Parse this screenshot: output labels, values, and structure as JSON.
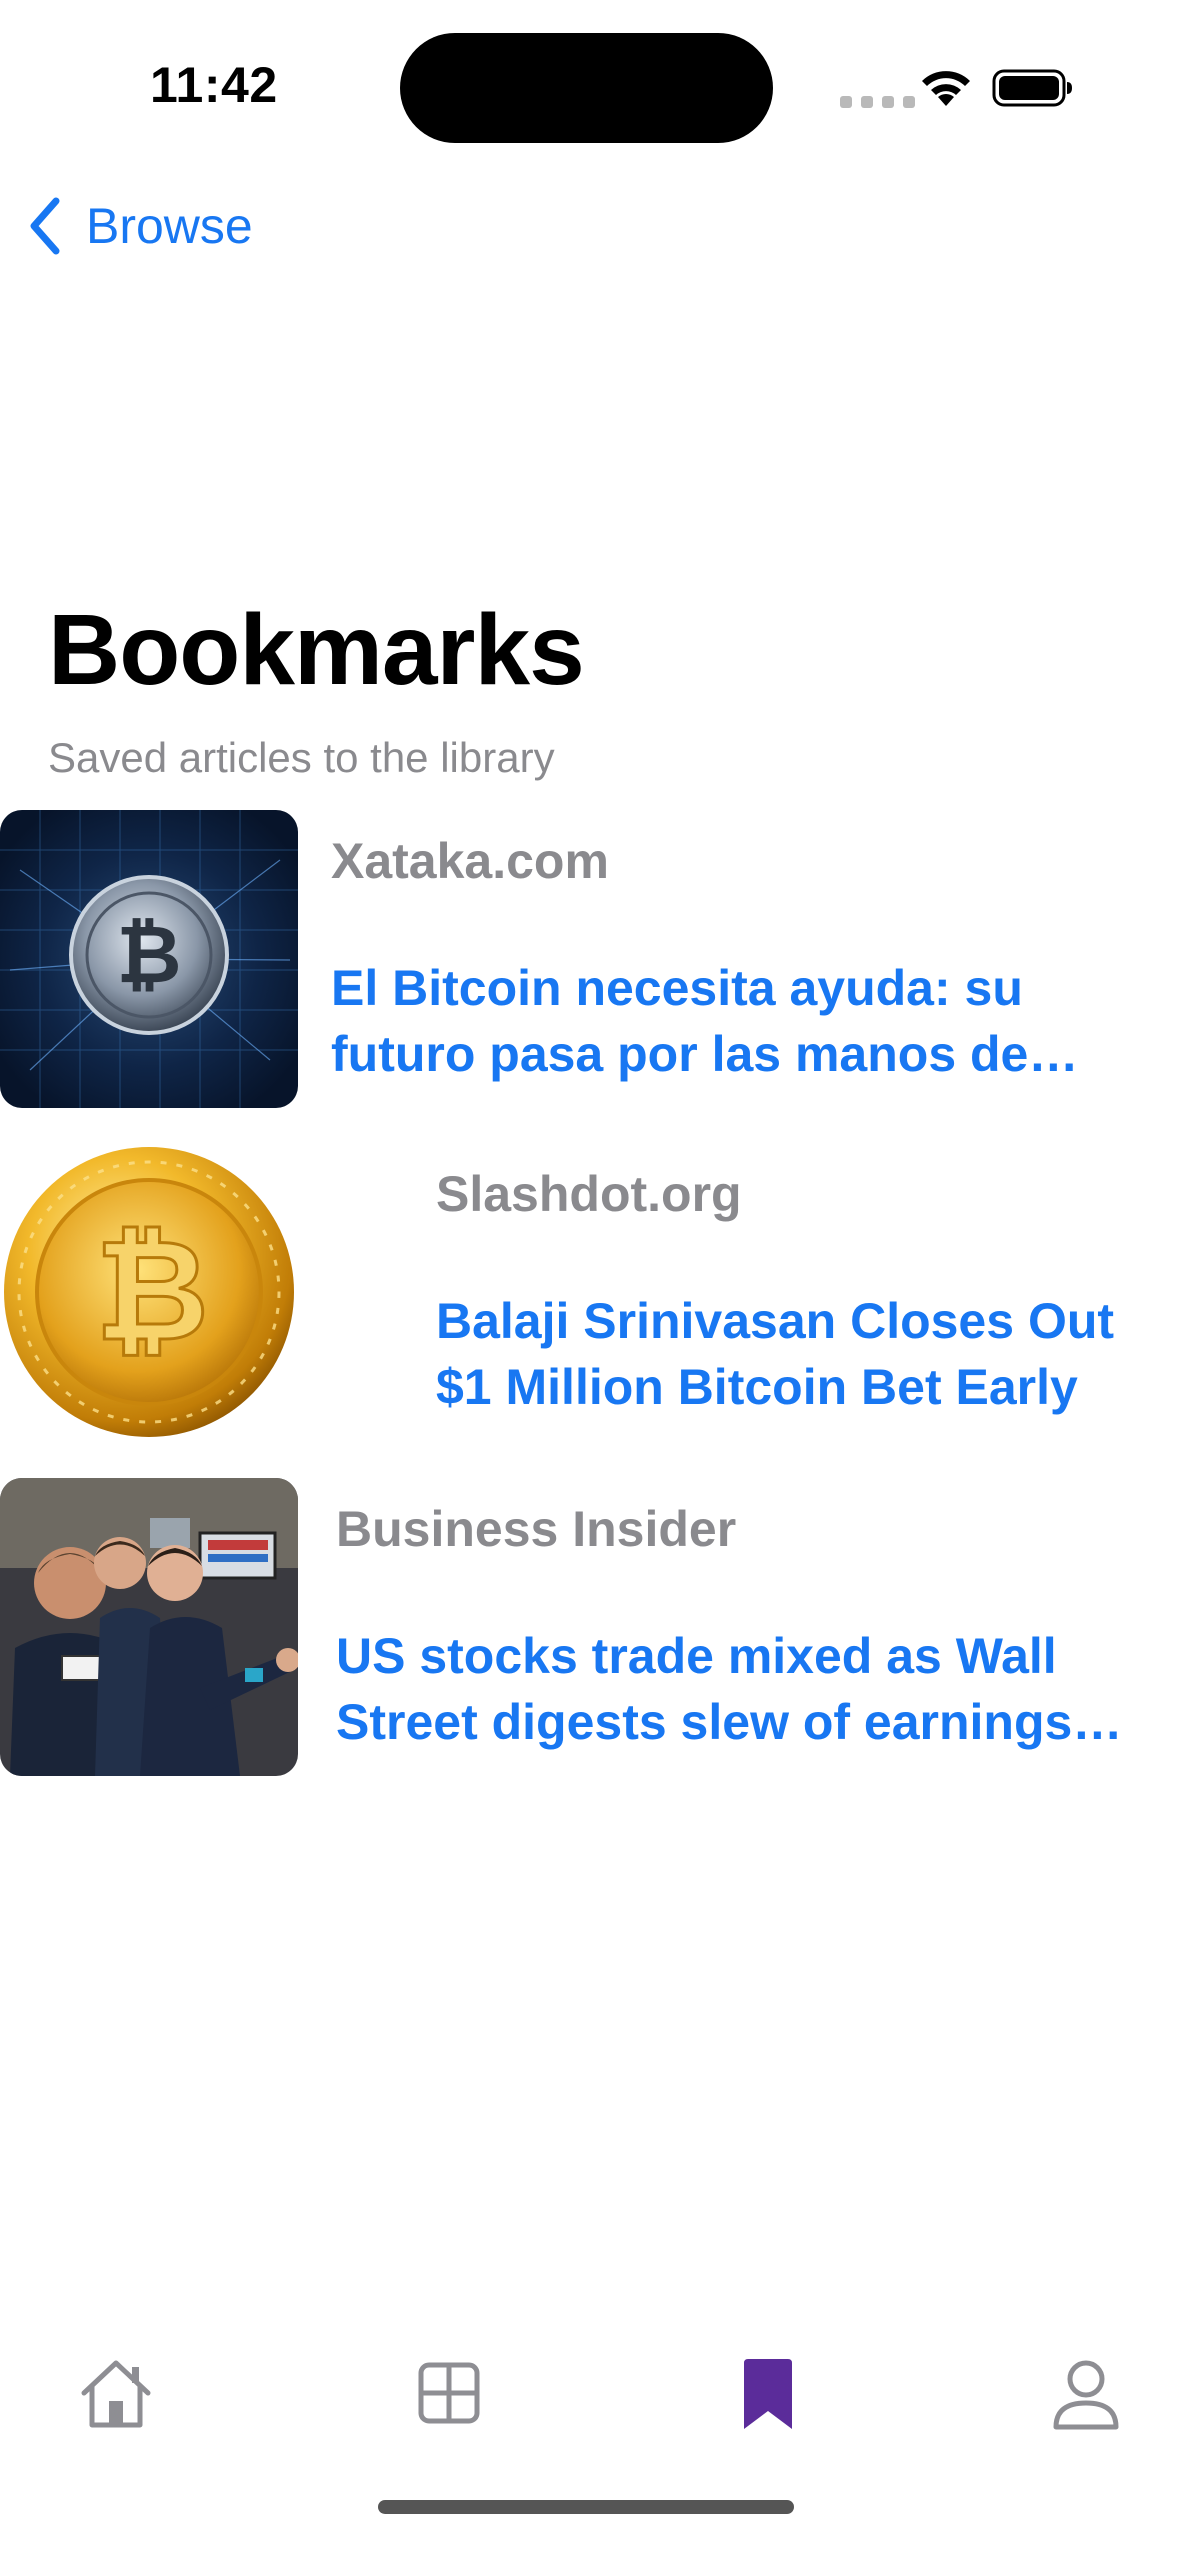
{
  "status_bar": {
    "time": "11:42"
  },
  "nav": {
    "back_label": "Browse",
    "back_icon": "chevron-left-icon"
  },
  "header": {
    "title": "Bookmarks",
    "subtitle": "Saved articles to the library"
  },
  "articles": [
    {
      "source": "Xataka.com",
      "headline": "El Bitcoin necesita ayuda: su futuro pasa por las manos de cuatro pro...",
      "image": "bitcoin-digital-network-image"
    },
    {
      "source": "Slashdot.org",
      "headline": "Balaji Srinivasan Closes Out $1 Million Bitcoin Bet Early",
      "image": "gold-bitcoin-coin-image"
    },
    {
      "source": "Business Insider",
      "headline": "US stocks trade mixed as Wall Street digests slew of earnings re...",
      "image": "stock-traders-photo"
    }
  ],
  "tab_bar": {
    "items": [
      {
        "icon": "home-icon"
      },
      {
        "icon": "grid-icon"
      },
      {
        "icon": "bookmark-icon",
        "selected": true
      },
      {
        "icon": "person-icon"
      }
    ]
  },
  "colors": {
    "accent_blue": "#1877f2",
    "secondary_gray": "#8a8a8e",
    "selected_tab_purple": "#5b2c9a",
    "tab_gray": "#8e8e93"
  }
}
